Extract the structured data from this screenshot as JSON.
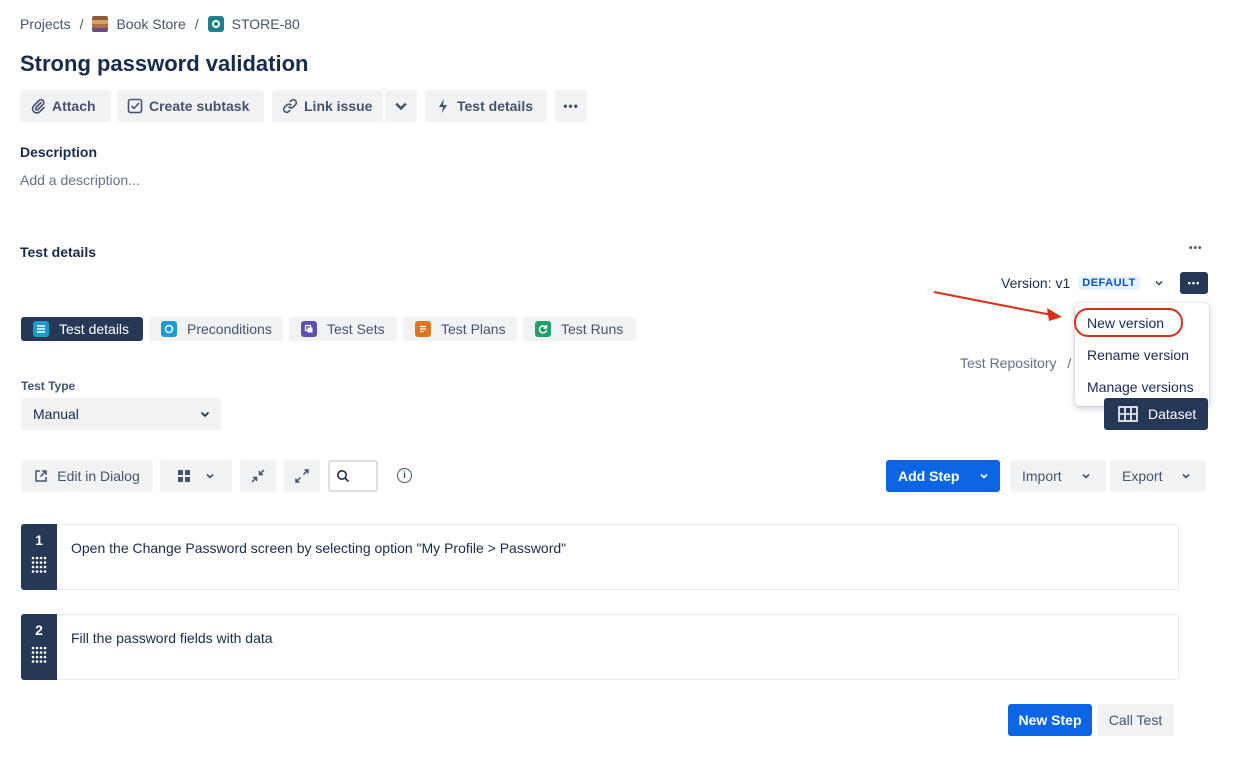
{
  "breadcrumb": {
    "projects": "Projects",
    "project": "Book Store",
    "issue": "STORE-80",
    "separator": "/"
  },
  "issue": {
    "title": "Strong password validation"
  },
  "toolbar": {
    "attach": "Attach",
    "create_subtask": "Create subtask",
    "link_issue": "Link issue",
    "test_details": "Test details",
    "more": "•••"
  },
  "description": {
    "label": "Description",
    "placeholder": "Add a description..."
  },
  "test_details_section": {
    "title": "Test details",
    "more": "•••",
    "version_label": "Version: v1",
    "version_badge": "DEFAULT",
    "version_more": "•••"
  },
  "version_menu": {
    "items": [
      "New version",
      "Rename version",
      "Manage versions"
    ],
    "highlight_color": "#d8311b"
  },
  "tabs": [
    {
      "label": "Test details",
      "icon": "list-icon",
      "color": "#1d9bd1"
    },
    {
      "label": "Preconditions",
      "icon": "precondition-icon",
      "color": "#1d9bd1"
    },
    {
      "label": "Test Sets",
      "icon": "test-set-icon",
      "color": "#5e4db2"
    },
    {
      "label": "Test Plans",
      "icon": "test-plan-icon",
      "color": "#e2731f"
    },
    {
      "label": "Test Runs",
      "icon": "test-run-icon",
      "color": "#22a06b"
    }
  ],
  "repository": {
    "label": "Test Repository",
    "separator": "/"
  },
  "test_type": {
    "label": "Test Type",
    "value": "Manual"
  },
  "dataset": {
    "label": "Dataset"
  },
  "steps_toolbar": {
    "edit_in_dialog": "Edit in Dialog",
    "info": "i",
    "add_step": "Add Step",
    "import": "Import",
    "export": "Export"
  },
  "steps": [
    {
      "number": "1",
      "action": "Open the Change Password screen by selecting option \"My Profile > Password\""
    },
    {
      "number": "2",
      "action": "Fill the password fields with data"
    }
  ],
  "footer": {
    "new_step": "New Step",
    "call_test": "Call Test"
  },
  "colors": {
    "primary": "#0c66e4",
    "dark": "#253858",
    "annotation": "#d8311b"
  }
}
